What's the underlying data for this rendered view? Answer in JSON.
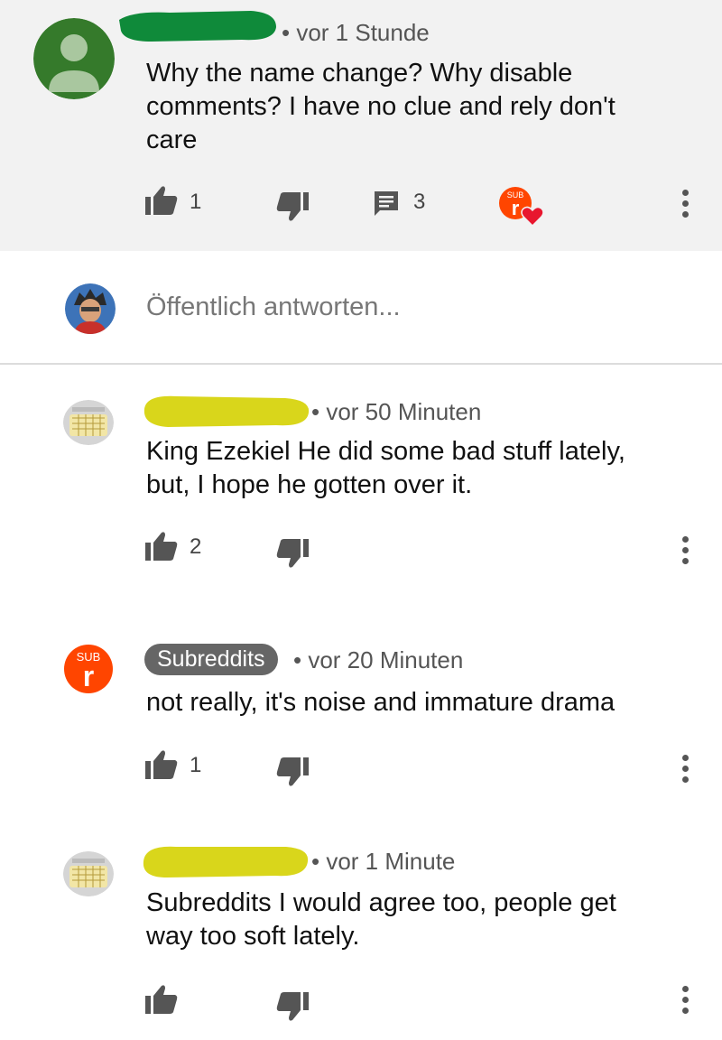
{
  "top_comment": {
    "time": "vor 1 Stunde",
    "text_lines": [
      "Why the name change? Why disable",
      "comments? I have no clue and rely don't",
      "care"
    ],
    "likes": "1",
    "replies": "3",
    "creator_badge": "SUB"
  },
  "reply_box": {
    "placeholder": "Öffentlich antworten..."
  },
  "replies": [
    {
      "time": "vor 50 Minuten",
      "text_lines": [
        "King Ezekiel He did some bad stuff lately,",
        "but, I hope he gotten over it."
      ],
      "likes": "2"
    },
    {
      "author": "Subreddits",
      "avatar_badge": "SUB",
      "time": "vor 20 Minuten",
      "text_lines": [
        "not really, it's noise and immature drama"
      ],
      "likes": "1"
    },
    {
      "time": "vor 1 Minute",
      "text_lines": [
        "Subreddits I would agree too, people get",
        "way too soft lately."
      ],
      "likes": ""
    }
  ],
  "colors": {
    "top_bg": "#f2f2f2",
    "redact_green": "#0f8a3a",
    "redact_yellow": "#d9d61b",
    "reddit_orange": "#ff4500",
    "heart_red": "#e8162e",
    "avatar_green": "#357a2b"
  },
  "icons": [
    "thumb-up-icon",
    "thumb-down-icon",
    "comment-icon",
    "more-vert-icon",
    "heart-icon"
  ]
}
